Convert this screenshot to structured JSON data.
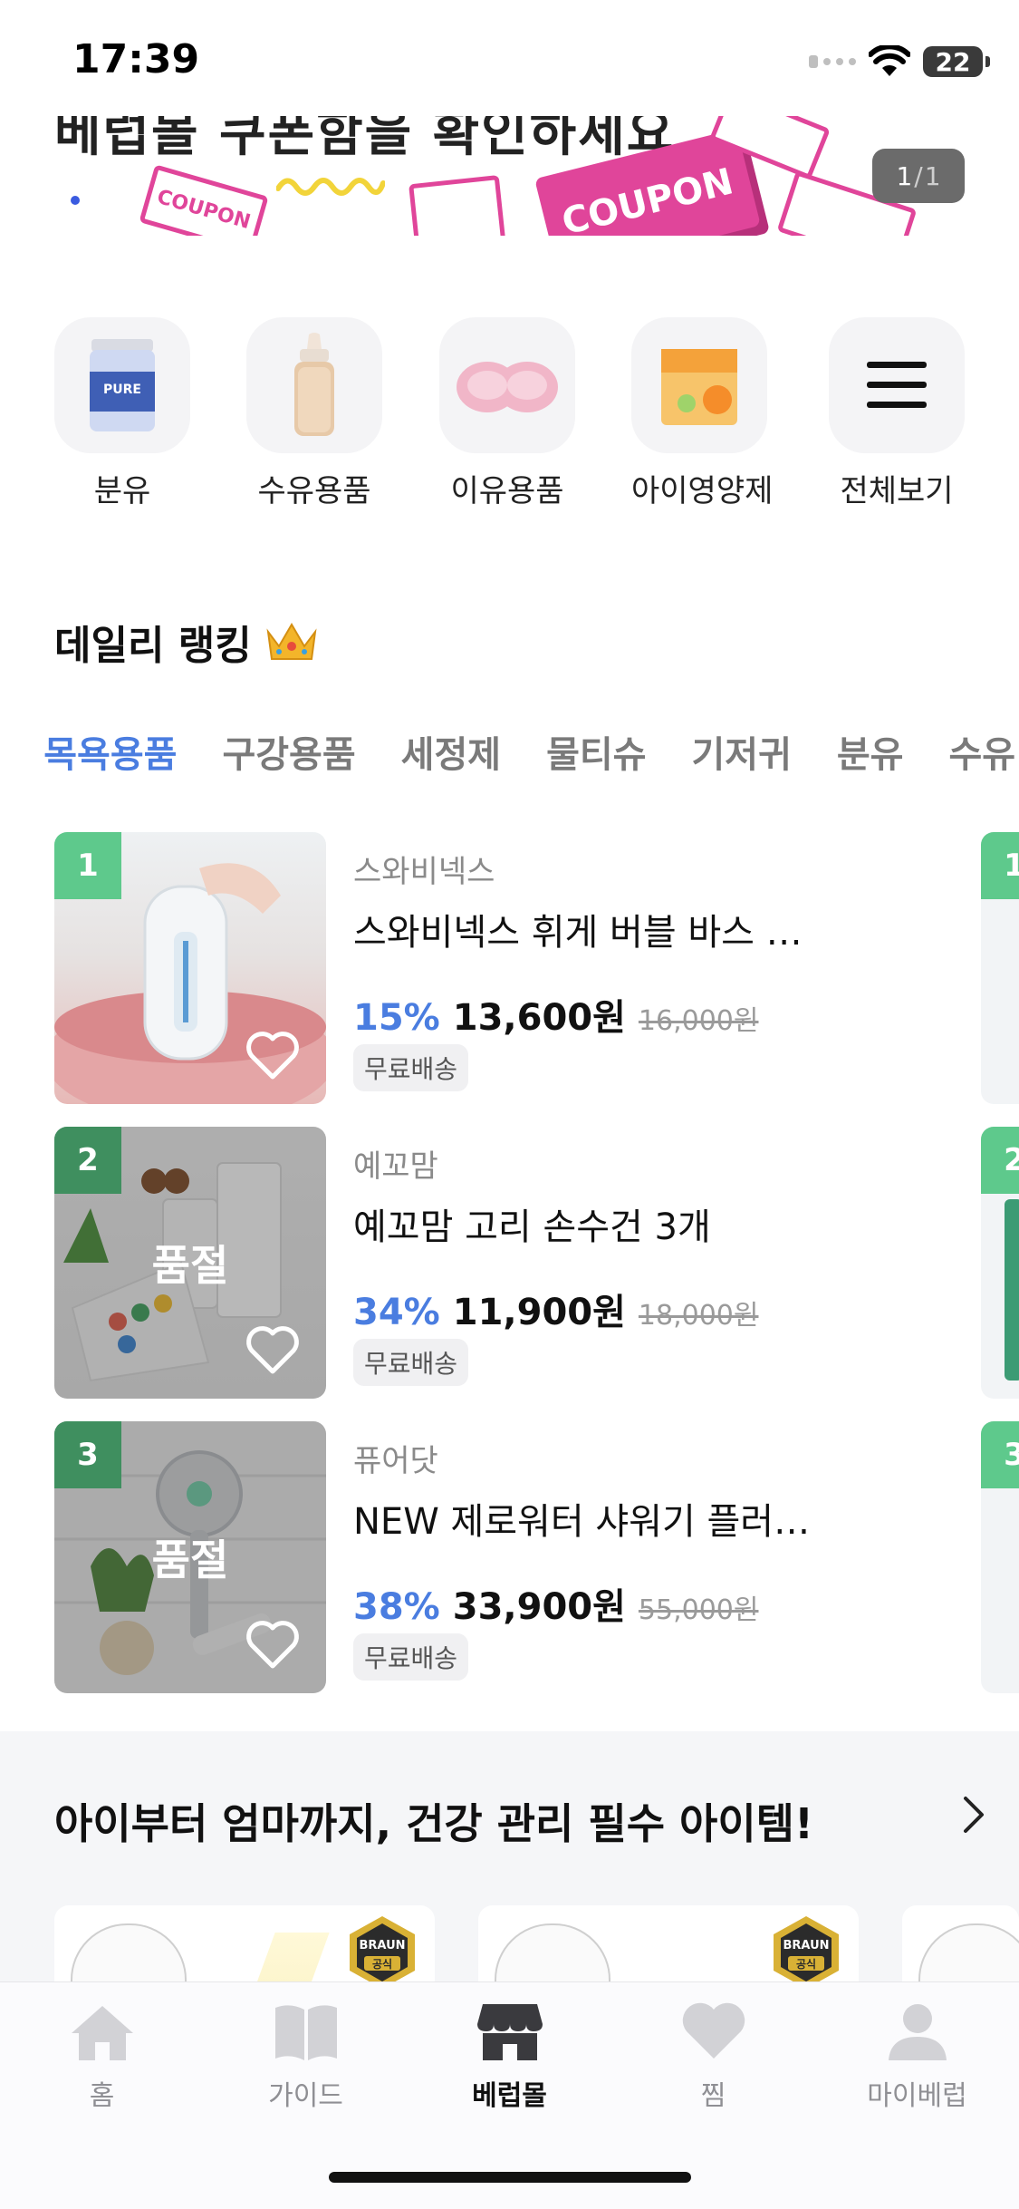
{
  "status_bar": {
    "time": "17:39",
    "battery": "22"
  },
  "banner": {
    "headline": "베럽몰 쿠폰함을 확인하세요",
    "coupon_main_text": "COUPON",
    "coupon_small_text": "COUPON",
    "page_current": "1",
    "page_separator": "/",
    "page_total": "1"
  },
  "categories": [
    {
      "label": "분유",
      "icon": "formula-can-icon"
    },
    {
      "label": "수유용품",
      "icon": "baby-bottle-icon"
    },
    {
      "label": "이유용품",
      "icon": "baby-bowl-icon"
    },
    {
      "label": "아이영양제",
      "icon": "supplement-box-icon"
    },
    {
      "label": "전체보기",
      "icon": "menu-icon"
    }
  ],
  "ranking": {
    "title": "데일리 랭킹",
    "title_icon": "crown-icon",
    "tabs": [
      "!",
      "목욕용품",
      "구강용품",
      "세정제",
      "물티슈",
      "기저귀",
      "분유",
      "수유"
    ],
    "active_tab": "목욕용품",
    "items": [
      {
        "rank": "1",
        "brand": "스와비넥스",
        "name": "스와비넥스 휘게 버블 바스 …",
        "discount": "15%",
        "price": "13,600원",
        "original_price": "16,000원",
        "shipping": "무료배송",
        "soldout": ""
      },
      {
        "rank": "2",
        "brand": "예꼬맘",
        "name": "예꼬맘 고리 손수건 3개",
        "discount": "34%",
        "price": "11,900원",
        "original_price": "18,000원",
        "shipping": "무료배송",
        "soldout": "품절"
      },
      {
        "rank": "3",
        "brand": "퓨어닷",
        "name": "NEW 제로워터 샤워기 플러…",
        "discount": "38%",
        "price": "33,900원",
        "original_price": "55,000원",
        "shipping": "무료배송",
        "soldout": "품절"
      }
    ],
    "peek_ranks": [
      "1",
      "2",
      "3"
    ]
  },
  "health_section": {
    "title": "아이부터 엄마까지, 건강 관리 필수 아이템!",
    "badge_brand": "BRAUN",
    "badge_label": "공식"
  },
  "tabbar": {
    "items": [
      {
        "label": "홈",
        "icon": "home-icon"
      },
      {
        "label": "가이드",
        "icon": "book-icon"
      },
      {
        "label": "베럽몰",
        "icon": "store-icon"
      },
      {
        "label": "찜",
        "icon": "heart-icon"
      },
      {
        "label": "마이베럽",
        "icon": "person-icon"
      }
    ],
    "active": "베럽몰"
  },
  "colors": {
    "accent": "#4a7de0",
    "rank_badge": "#5ec98c",
    "coupon_pink": "#e0459a"
  }
}
